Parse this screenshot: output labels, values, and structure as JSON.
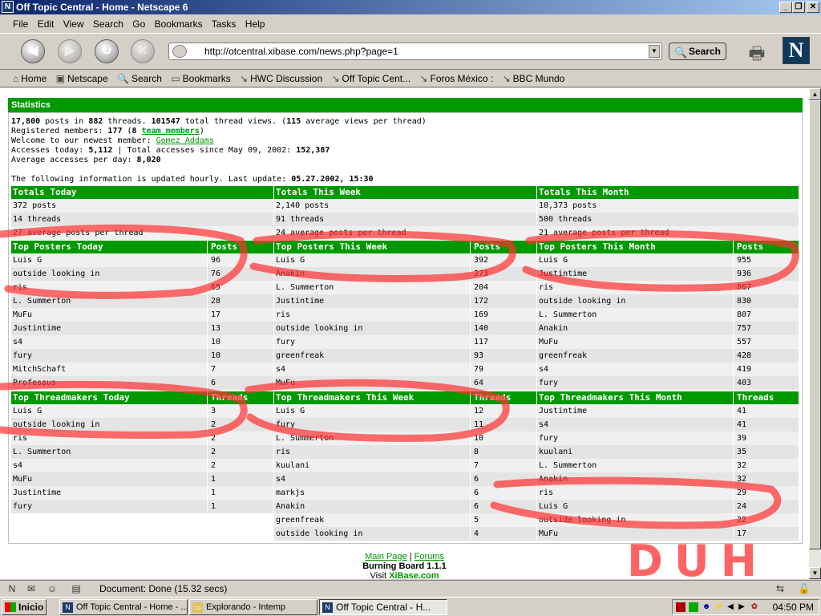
{
  "window": {
    "title": "Off Topic Central - Home - Netscape 6"
  },
  "menu": [
    "File",
    "Edit",
    "View",
    "Search",
    "Go",
    "Bookmarks",
    "Tasks",
    "Help"
  ],
  "nav": {
    "url": "http://otcentral.xibase.com/news.php?page=1",
    "search_label": "Search"
  },
  "bookmarks": [
    "Home",
    "Netscape",
    "Search",
    "Bookmarks",
    "HWC Discussion",
    "Off Topic Cent...",
    "Foros México :",
    "BBC Mundo"
  ],
  "stats": {
    "header": "Statistics",
    "line1": {
      "posts": "17,800",
      "mid1": " posts in ",
      "threads": "882",
      "mid2": " threads. ",
      "views": "101547",
      "mid3": " total thread views. (",
      "avg": "115",
      "mid4": " average views per thread)"
    },
    "line2": {
      "label": "Registered members: ",
      "count": "177",
      "mid": " (",
      "team_count": "8",
      "team": "team members",
      "end": ")"
    },
    "line3": {
      "label": "Welcome to our newest member: ",
      "member": "Gomez Addams"
    },
    "line4": {
      "label": "Accesses today: ",
      "today": "5,112",
      "mid": " | Total accesses since May 09, 2002: ",
      "total": "152,387"
    },
    "line5": {
      "label": "Average accesses per day: ",
      "avg": "8,020"
    },
    "line6": {
      "label": "The following information is updated hourly. Last update: ",
      "time": "05.27.2002, 15:30"
    }
  },
  "totals": [
    {
      "title": "Totals Today",
      "rows": [
        "372 posts",
        "14 threads",
        "27 average posts per thread"
      ]
    },
    {
      "title": "Totals This Week",
      "rows": [
        "2,140 posts",
        "91 threads",
        "24 average posts per thread"
      ]
    },
    {
      "title": "Totals This Month",
      "rows": [
        "10,373 posts",
        "500 threads",
        "21 average posts per thread"
      ]
    }
  ],
  "posters": [
    {
      "title": "Top Posters Today",
      "col": "Posts",
      "rows": [
        [
          "Luis G",
          "96"
        ],
        [
          "outside looking in",
          "76"
        ],
        [
          "ris",
          "65"
        ],
        [
          "L. Summerton",
          "28"
        ],
        [
          "MuFu",
          "17"
        ],
        [
          "Justintime",
          "13"
        ],
        [
          "s4",
          "10"
        ],
        [
          "fury",
          "10"
        ],
        [
          "MitchSchaft",
          "7"
        ],
        [
          "Professus",
          "6"
        ]
      ]
    },
    {
      "title": "Top Posters This Week",
      "col": "Posts",
      "rows": [
        [
          "Luis G",
          "392"
        ],
        [
          "Anakin",
          "273"
        ],
        [
          "L. Summerton",
          "204"
        ],
        [
          "Justintime",
          "172"
        ],
        [
          "ris",
          "169"
        ],
        [
          "outside looking in",
          "140"
        ],
        [
          "fury",
          "117"
        ],
        [
          "greenfreak",
          "93"
        ],
        [
          "s4",
          "79"
        ],
        [
          "MuFu",
          "64"
        ]
      ]
    },
    {
      "title": "Top Posters This Month",
      "col": "Posts",
      "rows": [
        [
          "Luis G",
          "955"
        ],
        [
          "Justintime",
          "936"
        ],
        [
          "ris",
          "867"
        ],
        [
          "outside looking in",
          "830"
        ],
        [
          "L. Summerton",
          "807"
        ],
        [
          "Anakin",
          "757"
        ],
        [
          "MuFu",
          "557"
        ],
        [
          "greenfreak",
          "428"
        ],
        [
          "s4",
          "419"
        ],
        [
          "fury",
          "403"
        ]
      ]
    }
  ],
  "threadmakers": [
    {
      "title": "Top Threadmakers Today",
      "col": "Threads",
      "rows": [
        [
          "Luis G",
          "3"
        ],
        [
          "outside looking in",
          "2"
        ],
        [
          "ris",
          "2"
        ],
        [
          "L. Summerton",
          "2"
        ],
        [
          "s4",
          "2"
        ],
        [
          "MuFu",
          "1"
        ],
        [
          "Justintime",
          "1"
        ],
        [
          "fury",
          "1"
        ]
      ]
    },
    {
      "title": "Top Threadmakers This Week",
      "col": "Threads",
      "rows": [
        [
          "Luis G",
          "12"
        ],
        [
          "fury",
          "11"
        ],
        [
          "L. Summerton",
          "10"
        ],
        [
          "ris",
          "8"
        ],
        [
          "kuulani",
          "7"
        ],
        [
          "s4",
          "6"
        ],
        [
          "markjs",
          "6"
        ],
        [
          "Anakin",
          "6"
        ],
        [
          "greenfreak",
          "5"
        ],
        [
          "outside looking in",
          "4"
        ]
      ]
    },
    {
      "title": "Top Threadmakers This Month",
      "col": "Threads",
      "rows": [
        [
          "Justintime",
          "41"
        ],
        [
          "s4",
          "41"
        ],
        [
          "fury",
          "39"
        ],
        [
          "kuulani",
          "35"
        ],
        [
          "L. Summerton",
          "32"
        ],
        [
          "Anakin",
          "32"
        ],
        [
          "ris",
          "29"
        ],
        [
          "Luis G",
          "24"
        ],
        [
          "outside looking in",
          "22"
        ],
        [
          "MuFu",
          "17"
        ]
      ]
    }
  ],
  "footer": {
    "main": "Main Page",
    "sep": " | ",
    "forums": "Forums",
    "board": "Burning Board 1.1.1",
    "visit": "Visit ",
    "site": "XiBase.com"
  },
  "annotation": {
    "text": "DUH",
    "color": "#ff3030"
  },
  "status": {
    "message": "Document: Done (15.32 secs)"
  },
  "taskbar": {
    "start": "Inicio",
    "tasks": [
      "Off Topic Central - Home - ...",
      "Explorando - Intemp",
      "Off Topic Central - H..."
    ],
    "clock": "04:50 PM"
  },
  "colors": {
    "accent": "#009900",
    "title_bar": "#0a246a"
  }
}
